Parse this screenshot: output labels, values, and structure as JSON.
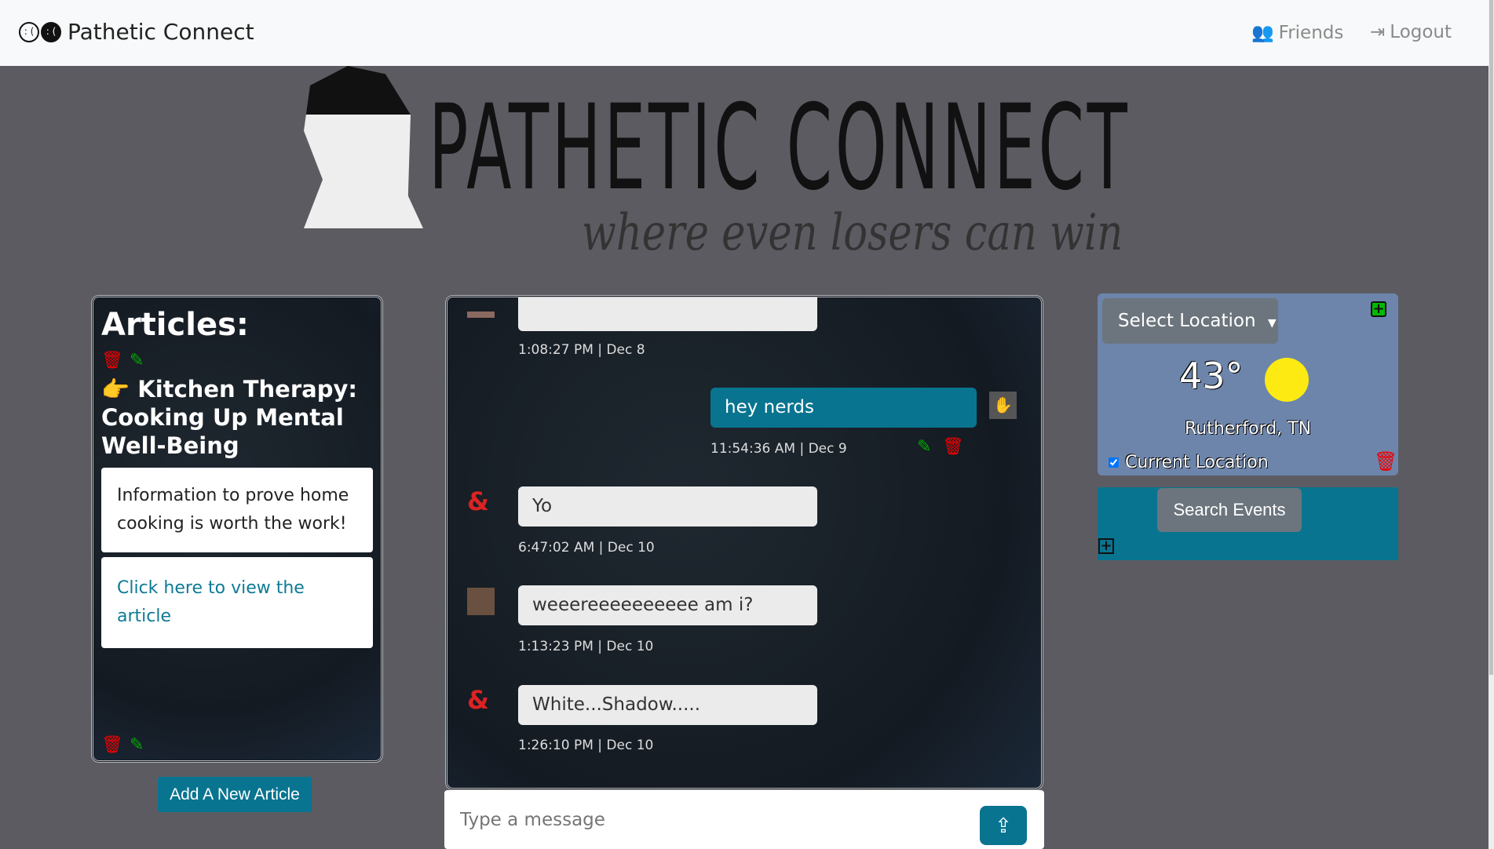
{
  "nav": {
    "brand": "Pathetic Connect",
    "friends": "Friends",
    "logout": "Logout",
    "icons": [
      "sad-face-icon",
      "users-icon",
      "logout-icon"
    ]
  },
  "banner": {
    "title": "PATHETIC CONNECT",
    "tagline": "where even losers can win"
  },
  "articles": {
    "heading": "Articles:",
    "items": [
      {
        "title": "Kitchen Therapy: Cooking Up Mental Well-Being",
        "description": "Information to prove home cooking is worth the work!",
        "link": "Click here to view the article"
      }
    ],
    "add_button": "Add A New Article"
  },
  "chat": {
    "messages": [
      {
        "text": "",
        "time": "1:08:27 PM | Dec 8",
        "own": false
      },
      {
        "text": "hey nerds",
        "time": "11:54:36 AM | Dec 9",
        "own": true
      },
      {
        "text": "Yo",
        "time": "6:47:02 AM | Dec 10",
        "own": false
      },
      {
        "text": "weeereeeeeeeeee am i?",
        "time": "1:13:23 PM | Dec 10",
        "own": false
      },
      {
        "text": "White...Shadow.....",
        "time": "1:26:10 PM | Dec 10",
        "own": false
      }
    ],
    "placeholder": "Type a message"
  },
  "weather": {
    "select_label": "Select Location",
    "temperature": "43°",
    "location": "Rutherford, TN",
    "current_location_label": "Current Location",
    "current_location_checked": true,
    "condition_icon": "sun-icon"
  },
  "events": {
    "search_button": "Search Events"
  },
  "colors": {
    "accent": "#087490",
    "background": "#5d5b62",
    "weather_bg": "#6d85ab",
    "delete": "#e00000",
    "edit": "#00a000"
  }
}
